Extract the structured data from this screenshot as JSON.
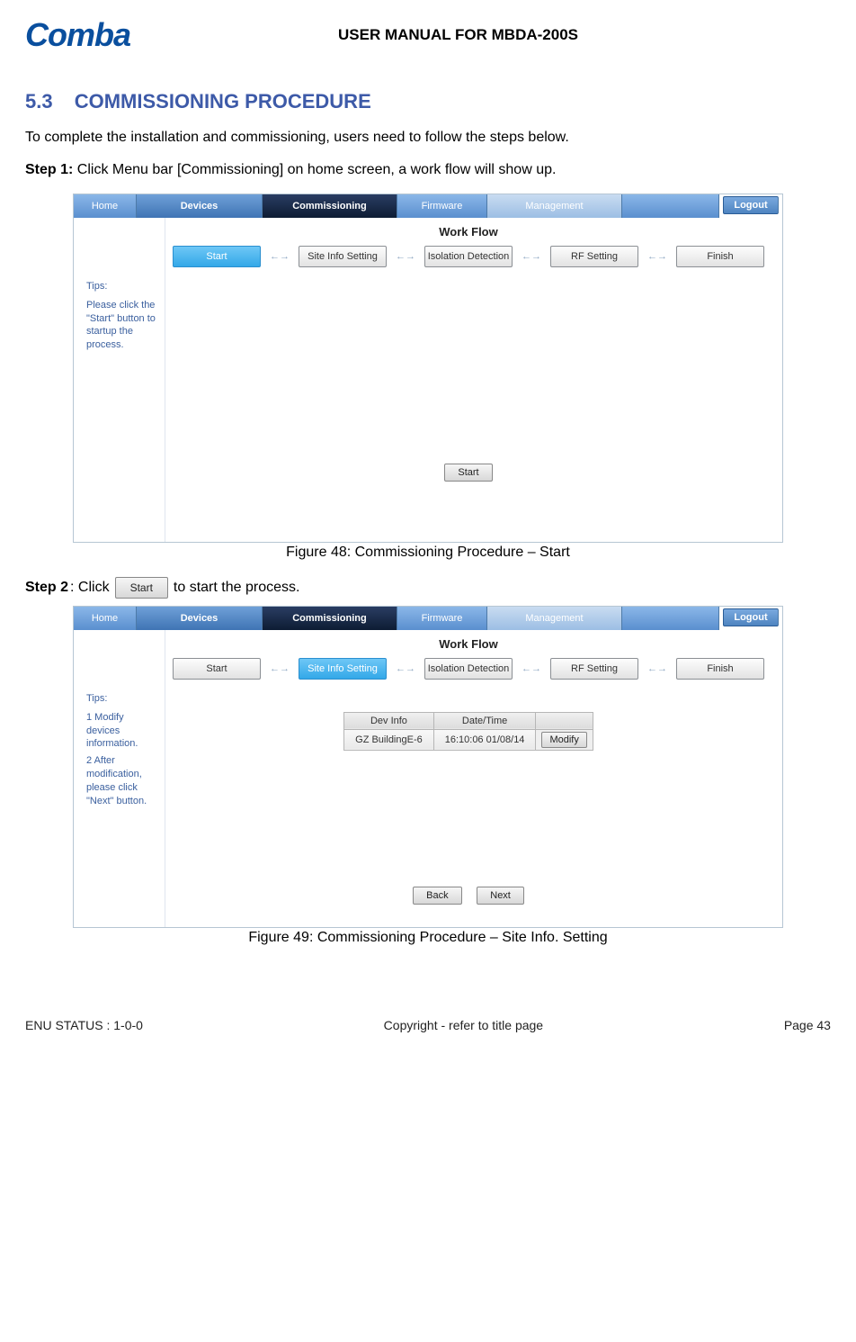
{
  "header": {
    "logo_text": "Comba",
    "doc_title": "USER MANUAL FOR MBDA-200S"
  },
  "section": {
    "number": "5.3",
    "title": "COMMISSIONING PROCEDURE"
  },
  "intro_text": "To complete the installation and commissioning, users need to follow the steps below.",
  "step1": {
    "prefix": "Step 1:",
    "text": " Click Menu bar [Commissioning] on home screen, a work flow will show up."
  },
  "menubar": {
    "home": "Home",
    "devices": "Devices",
    "commissioning": "Commissioning",
    "firmware": "Firmware",
    "management": "Management",
    "logout": "Logout"
  },
  "workflow": {
    "title": "Work Flow",
    "steps": [
      "Start",
      "Site Info Setting",
      "Isolation Detection",
      "RF Setting",
      "Finish"
    ]
  },
  "fig48": {
    "tips_heading": "Tips:",
    "tips_line1": "Please click the \"Start\" button to startup the process.",
    "start_button": "Start",
    "caption": "Figure 48: Commissioning Procedure – Start"
  },
  "step2": {
    "prefix": "Step 2",
    "mid": ": Click ",
    "button_label": "Start",
    "suffix": " to start the process."
  },
  "fig49": {
    "tips_heading": "Tips:",
    "tips_line1": "1 Modify devices information.",
    "tips_line2": "2 After modification, please click \"Next\" button.",
    "table": {
      "h1": "Dev Info",
      "h2": "Date/Time",
      "v1": "GZ BuildingE-6",
      "v2": "16:10:06 01/08/14",
      "modify": "Modify"
    },
    "back_button": "Back",
    "next_button": "Next",
    "caption": "Figure 49: Commissioning Procedure – Site Info. Setting"
  },
  "footer": {
    "status": "ENU STATUS : 1-0-0",
    "copyright": "Copyright - refer to title page",
    "page": "Page 43"
  }
}
